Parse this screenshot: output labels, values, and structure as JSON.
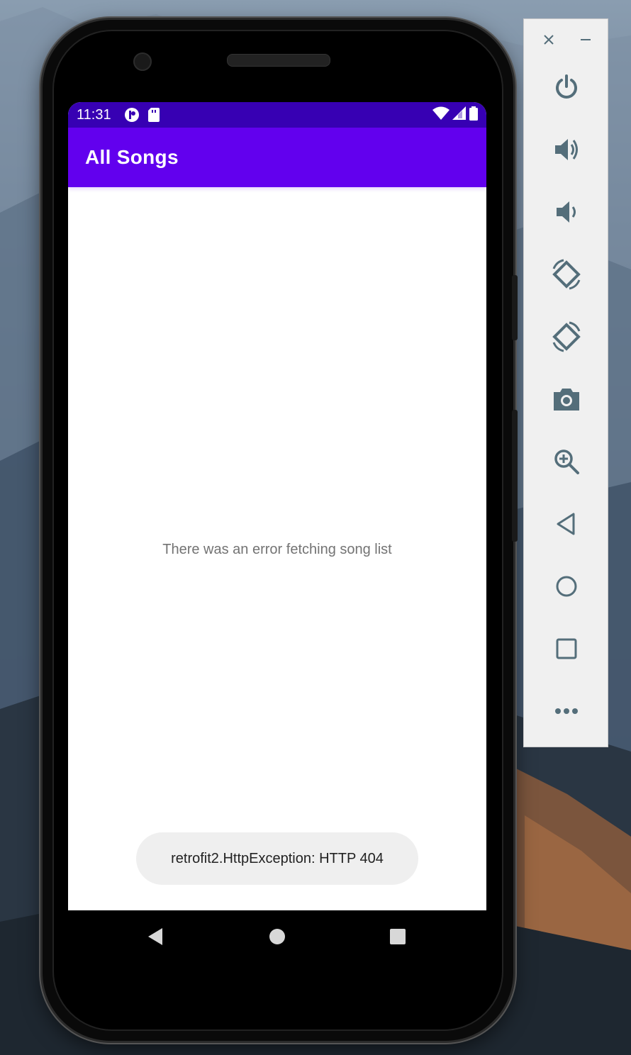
{
  "status_bar": {
    "time": "11:31"
  },
  "app_bar": {
    "title": "All Songs"
  },
  "content": {
    "error_message": "There was an error fetching song list"
  },
  "toast": {
    "message": "retrofit2.HttpException: HTTP 404"
  },
  "colors": {
    "status_bar": "#3700b3",
    "app_bar": "#6200ee",
    "panel_icon": "#546e7a"
  },
  "emulator_panel": {
    "controls": [
      "close-icon",
      "minimize-icon"
    ],
    "buttons": [
      "power-icon",
      "volume-up-icon",
      "volume-down-icon",
      "rotate-left-icon",
      "rotate-right-icon",
      "camera-icon",
      "zoom-icon",
      "back-icon",
      "home-icon",
      "overview-icon",
      "more-icon"
    ]
  }
}
